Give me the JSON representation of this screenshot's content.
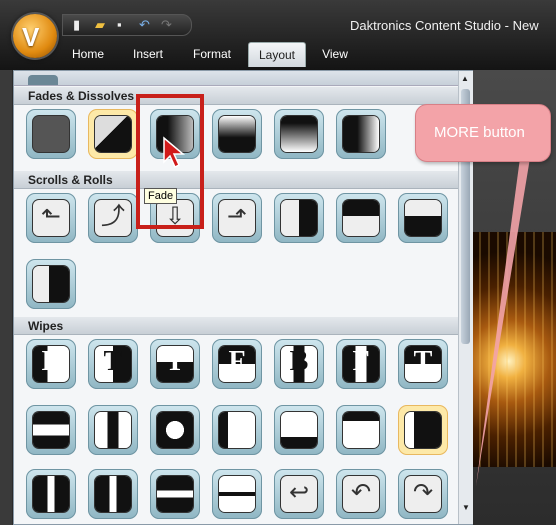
{
  "window": {
    "title": "Daktronics Content Studio - New"
  },
  "ribbon": {
    "tabs": [
      {
        "label": "Home"
      },
      {
        "label": "Insert"
      },
      {
        "label": "Format"
      },
      {
        "label": "Layout",
        "active": true
      },
      {
        "label": "View"
      }
    ]
  },
  "gallery": {
    "sections": [
      {
        "title": "Fades & Dissolves"
      },
      {
        "title": "Scrolls & Rolls"
      },
      {
        "title": "Wipes"
      }
    ],
    "selected_tile": "Fade",
    "tooltip": "Fade",
    "wipe_glyphs": [
      "B",
      "T",
      "T",
      "F",
      "B",
      "F",
      "T"
    ]
  },
  "annotation": {
    "callout": "MORE button",
    "colors": {
      "highlight": "#c8201a",
      "callout": "#f3a3a8"
    }
  }
}
